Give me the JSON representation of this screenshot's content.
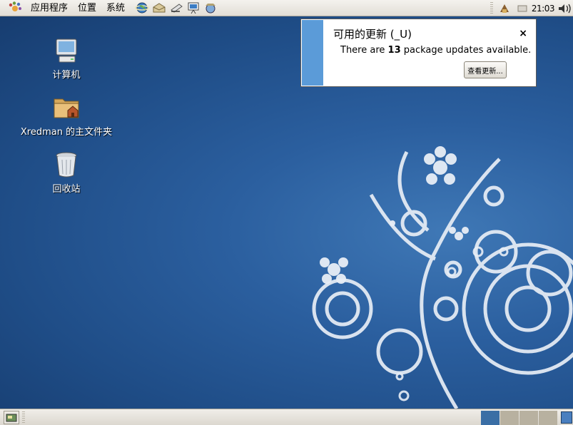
{
  "top_panel": {
    "menus": [
      "应用程序",
      "位置",
      "系统"
    ],
    "launchers": [
      "web-browser-icon",
      "email-client-icon",
      "text-editor-icon",
      "presentation-icon",
      "network-icon"
    ],
    "clock": "21:03"
  },
  "desktop": {
    "icons": [
      {
        "label": "计算机",
        "icon": "computer-icon"
      },
      {
        "label": "Xredman 的主文件夹",
        "icon": "home-folder-icon"
      },
      {
        "label": "回收站",
        "icon": "trash-icon"
      }
    ]
  },
  "notification": {
    "title": "可用的更新 (_U)",
    "body_prefix": "There are ",
    "count": "13",
    "body_suffix": " package updates available.",
    "button": "查看更新...",
    "close": "×"
  },
  "bottom_panel": {
    "workspaces": 4,
    "active_workspace": 1
  },
  "colors": {
    "desktop_blue": "#2b5f9f",
    "notification_stripe": "#5b9bd8",
    "panel_bg": "#ece9e3"
  }
}
